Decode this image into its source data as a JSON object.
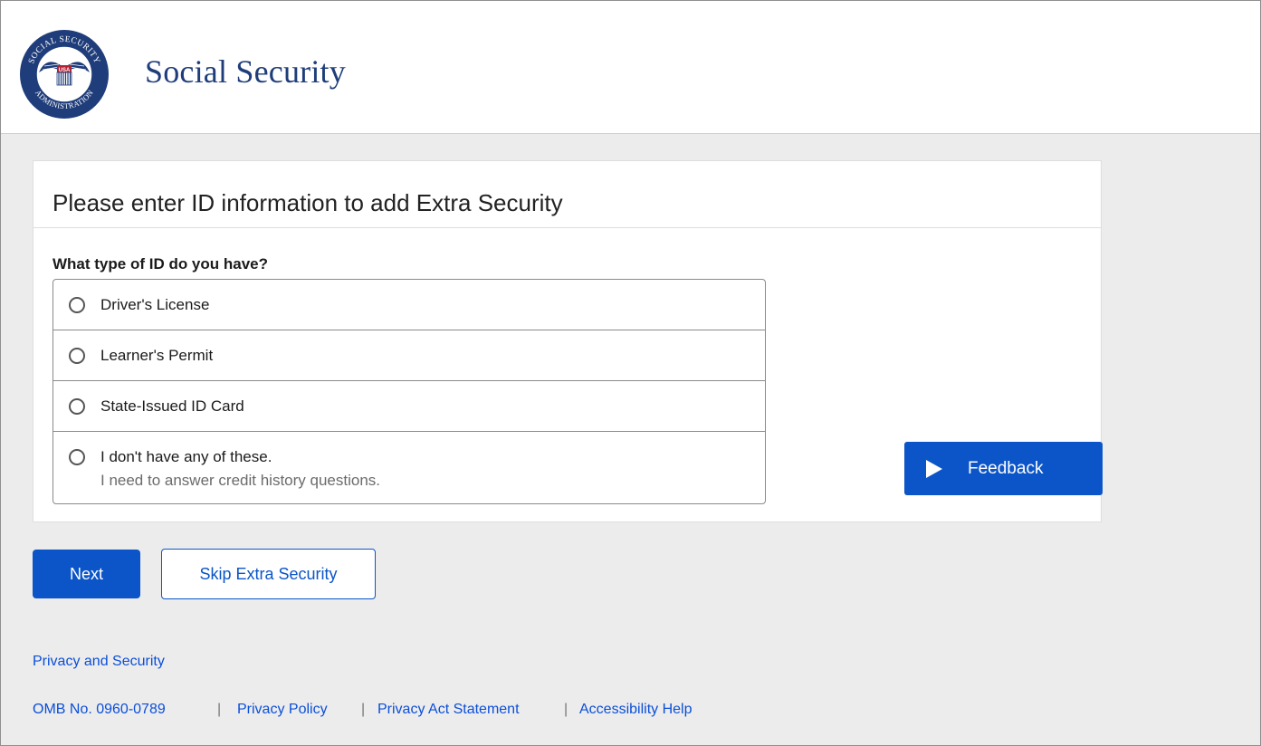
{
  "header": {
    "brand": "Social Security",
    "seal": {
      "top_text": "SOCIAL SECURITY",
      "bottom_text": "ADMINISTRATION",
      "badge": "USA"
    }
  },
  "card": {
    "title": "Please enter ID information to add Extra Security",
    "question": "What type of ID do you have?",
    "options": [
      {
        "label": "Driver's License",
        "selected": false
      },
      {
        "label": "Learner's Permit",
        "selected": false
      },
      {
        "label": "State-Issued ID Card",
        "selected": false
      },
      {
        "label": "I don't have any of these.",
        "sublabel": "I need to answer credit history questions.",
        "selected": false
      }
    ]
  },
  "feedback": {
    "label": "Feedback",
    "icon": "play-icon"
  },
  "actions": {
    "next_label": "Next",
    "skip_label": "Skip Extra Security"
  },
  "footer": {
    "privacy_security": "Privacy and Security",
    "omb": "OMB No. 0960-0789",
    "privacy_policy": "Privacy Policy",
    "privacy_act": "Privacy Act Statement",
    "accessibility": "Accessibility Help",
    "separator": "|"
  },
  "colors": {
    "primary": "#0b55c8",
    "link": "#0b4fd8",
    "brand_navy": "#1f3d7a",
    "page_bg": "#ececec"
  }
}
